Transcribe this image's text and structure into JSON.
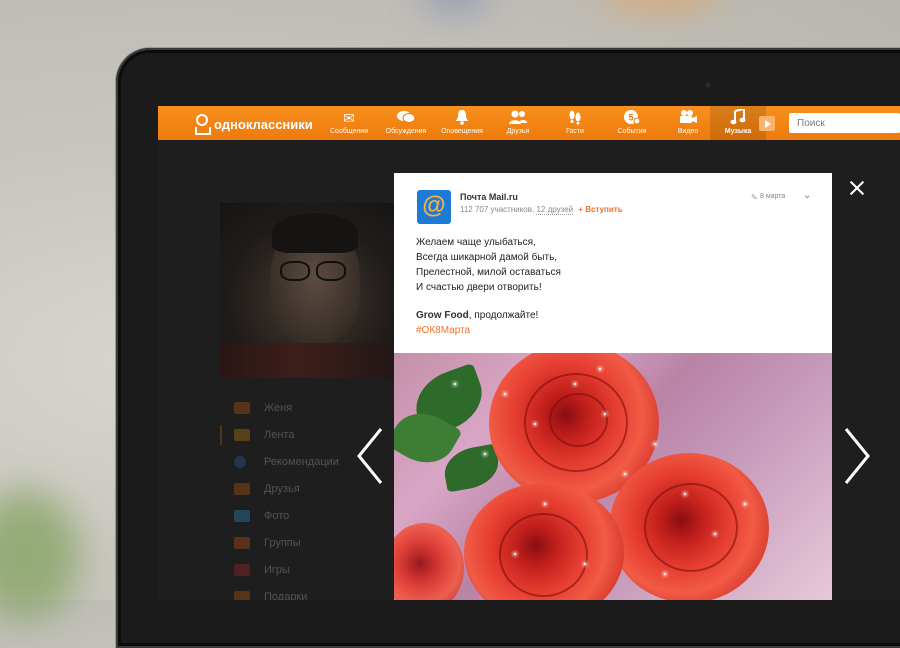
{
  "app": {
    "logo_text": "одноклассники"
  },
  "nav": {
    "items": [
      {
        "label": "Сообщения",
        "icon": "envelope-icon",
        "glyph": "✉"
      },
      {
        "label": "Обсуждения",
        "icon": "chat-bubbles-icon",
        "glyph": "💬"
      },
      {
        "label": "Оповещения",
        "icon": "bell-icon",
        "glyph": "🔔"
      },
      {
        "label": "Друзья",
        "icon": "people-icon",
        "glyph": "👥"
      },
      {
        "label": "Гости",
        "icon": "footprints-icon",
        "glyph": "👣"
      },
      {
        "label": "События",
        "icon": "events-icon",
        "glyph": "⚙"
      },
      {
        "label": "Видео",
        "icon": "video-camera-icon",
        "glyph": "🎥"
      },
      {
        "label": "Музыка",
        "icon": "music-note-icon",
        "glyph": "♪",
        "active": true
      }
    ],
    "search_placeholder": "Поиск"
  },
  "sidebar": {
    "items": [
      {
        "label": "Женя",
        "color": "#c8641e"
      },
      {
        "label": "Лента",
        "color": "#c88c1e",
        "active": true
      },
      {
        "label": "Рекомендации",
        "color": "#2a73b8"
      },
      {
        "label": "Друзья",
        "color": "#c8641e"
      },
      {
        "label": "Фото",
        "color": "#3a9ad8"
      },
      {
        "label": "Группы",
        "color": "#c8641e"
      },
      {
        "label": "Игры",
        "color": "#b8303a"
      },
      {
        "label": "Подарки",
        "color": "#c8641e"
      }
    ]
  },
  "post": {
    "group_name": "Почта Mail.ru",
    "members": "112 707 участников,",
    "friends": "12 друзей",
    "join_label": "Вступить",
    "date": "8 марта",
    "lines": [
      "Желаем чаще улыбаться,",
      "Всегда шикарной дамой быть,",
      "Прелестной, милой оставаться",
      "И счастью двери отворить!"
    ],
    "mention_name": "Grow Food",
    "mention_suffix": ",  продолжайте!",
    "hashtag": "#ОК8Марта"
  },
  "colors": {
    "brand_orange": "#ee7a0c",
    "link_orange": "#eb722e",
    "group_logo_blue": "#1d7bd8"
  }
}
